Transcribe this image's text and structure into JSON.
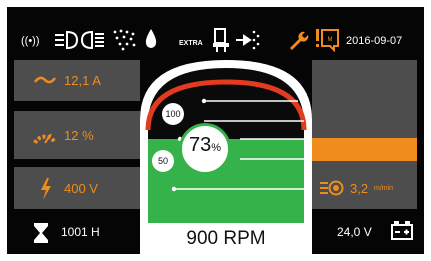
{
  "status_bar": {
    "date": "2016-09-07",
    "extra_label": "EXTRA",
    "icons": [
      "wireless-signal-icon",
      "low-beam-icon",
      "high-beam-icon",
      "sprayer-icon",
      "water-drop-icon",
      "seat-icon",
      "hydraulic-flow-icon",
      "wrench-icon",
      "maintenance-warning-icon"
    ]
  },
  "left_panels": [
    {
      "icon": "current-wave-icon",
      "value": "12,1 A"
    },
    {
      "icon": "speedometer-icon",
      "value": "12 %"
    },
    {
      "icon": "voltage-bolt-icon",
      "value": "400 V"
    }
  ],
  "right_panel": {
    "icon": "wire-feed-icon",
    "value": "3,2",
    "unit": "m/min"
  },
  "gauge": {
    "percent": "73",
    "percent_unit": "%",
    "label_high": "100",
    "label_low": "50",
    "rpm": "900 RPM",
    "fill_level": 0.73
  },
  "footer": {
    "hours": "1001 H",
    "voltage": "24,0 V"
  },
  "colors": {
    "accent": "#f08c1e",
    "gauge_green": "#36b24a",
    "panel_gray": "#4d4d4d",
    "redline": "#e23b1f"
  }
}
